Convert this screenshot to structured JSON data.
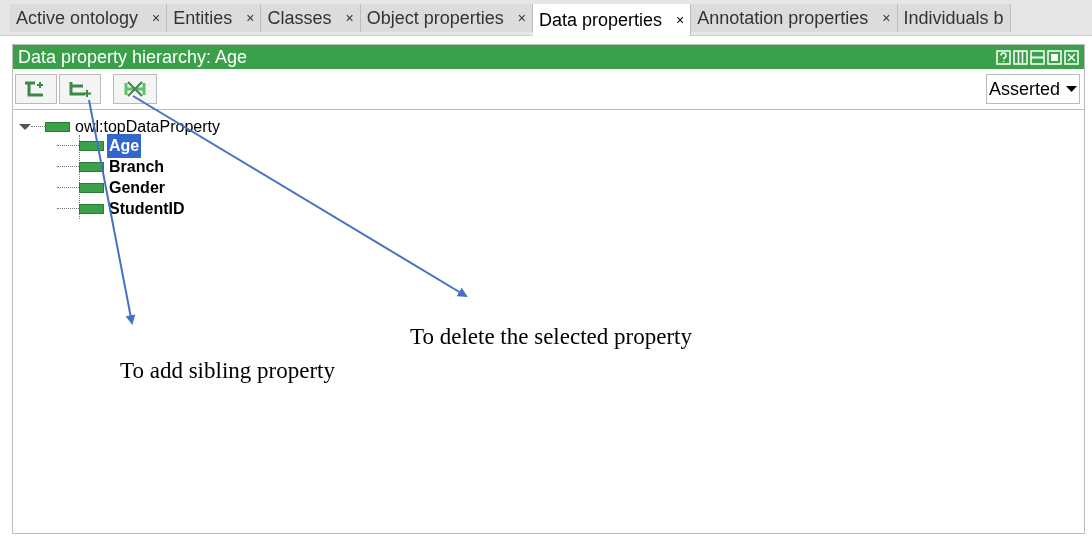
{
  "tabs": [
    {
      "label": "Active ontology",
      "close": "×",
      "selected": false
    },
    {
      "label": "Entities",
      "close": "×",
      "selected": false
    },
    {
      "label": "Classes",
      "close": "×",
      "selected": false
    },
    {
      "label": "Object properties",
      "close": "×",
      "selected": false
    },
    {
      "label": "Data properties",
      "close": "×",
      "selected": true
    },
    {
      "label": "Annotation properties",
      "close": "×",
      "selected": false
    },
    {
      "label": "Individuals b",
      "selected": false
    }
  ],
  "panel": {
    "title": "Data property hierarchy: Age",
    "view_select": {
      "value": "Asserted"
    }
  },
  "tree": [
    {
      "label": "owl:topDataProperty",
      "expanded": true,
      "selected": false,
      "children": [
        {
          "label": "Age",
          "selected": true
        },
        {
          "label": "Branch",
          "selected": false
        },
        {
          "label": "Gender",
          "selected": false
        },
        {
          "label": "StudentID",
          "selected": false
        }
      ]
    }
  ],
  "annotations": [
    {
      "text": "To delete the selected property",
      "kind": "delete"
    },
    {
      "text": "To add sibling property",
      "kind": "sibling"
    }
  ]
}
